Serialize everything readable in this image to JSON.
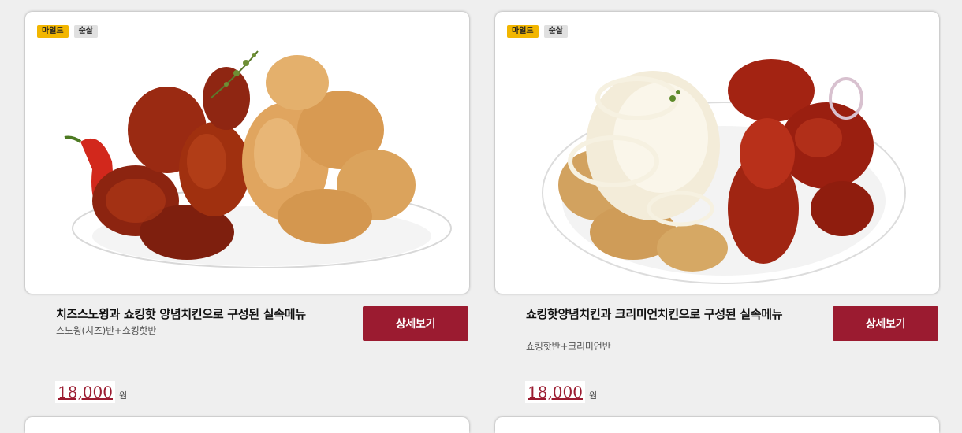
{
  "products": [
    {
      "image_alt": "치즈스노윙과 쇼킹핫 양념치킨 접시",
      "badges": [
        "마일드",
        "순살"
      ],
      "title": "치즈스노윙과 쇼킹핫 양념치킨으로 구성된 실속메뉴",
      "subtitle": "스노윙(치즈)반+쇼킹핫반",
      "button_label": "상세보기",
      "price": "18,000",
      "currency": "원"
    },
    {
      "image_alt": "쇼킹핫양념치킨과 크리미언치킨 접시",
      "badges": [
        "마일드",
        "순살"
      ],
      "title": "쇼킹핫양념치킨과 크리미언치킨으로 구성된 실속메뉴",
      "subtitle": "쇼킹핫반+크리미언반",
      "button_label": "상세보기",
      "price": "18,000",
      "currency": "원"
    }
  ],
  "colors": {
    "accent": "#9b1b30",
    "mild_badge": "#f2b600",
    "bone_badge": "#e0e0e0",
    "background": "#efefef"
  }
}
